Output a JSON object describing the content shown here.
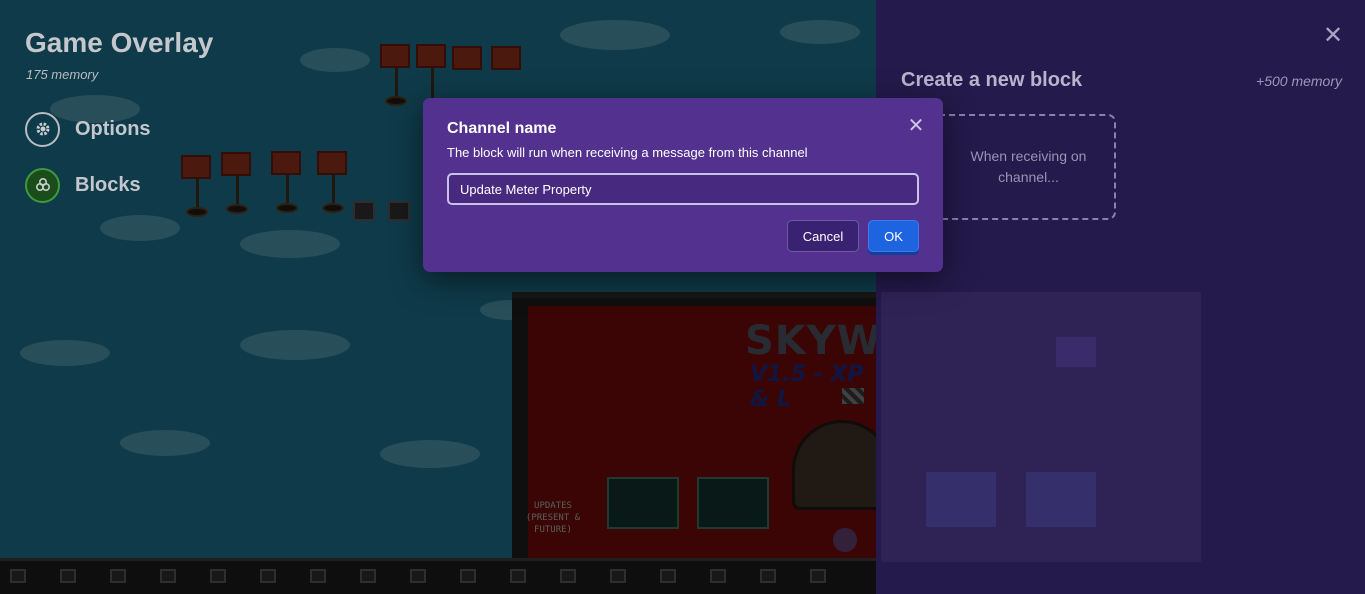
{
  "sidebar": {
    "title": "Game Overlay",
    "memory": "175 memory",
    "items": [
      {
        "label": "Options",
        "icon": "gear-icon"
      },
      {
        "label": "Blocks",
        "icon": "blocks-icon"
      }
    ]
  },
  "scene": {
    "banner_title": "SKYWA",
    "banner_subtitle": "V1.5 - XP & L",
    "update_text": "UPDATES (PRESENT & FUTURE)"
  },
  "panel": {
    "title": "Create a new block",
    "memory": "+500 memory",
    "block_card_label": "When receiving on channel..."
  },
  "modal": {
    "title": "Channel name",
    "description": "The block will run when receiving a message from this channel",
    "input_value": "Update Meter Property",
    "cancel_label": "Cancel",
    "ok_label": "OK"
  },
  "colors": {
    "modal_bg": "#53318f",
    "panel_bg": "#241a4b",
    "ok_button": "#1e63e0",
    "sky": "#1d6b86"
  }
}
